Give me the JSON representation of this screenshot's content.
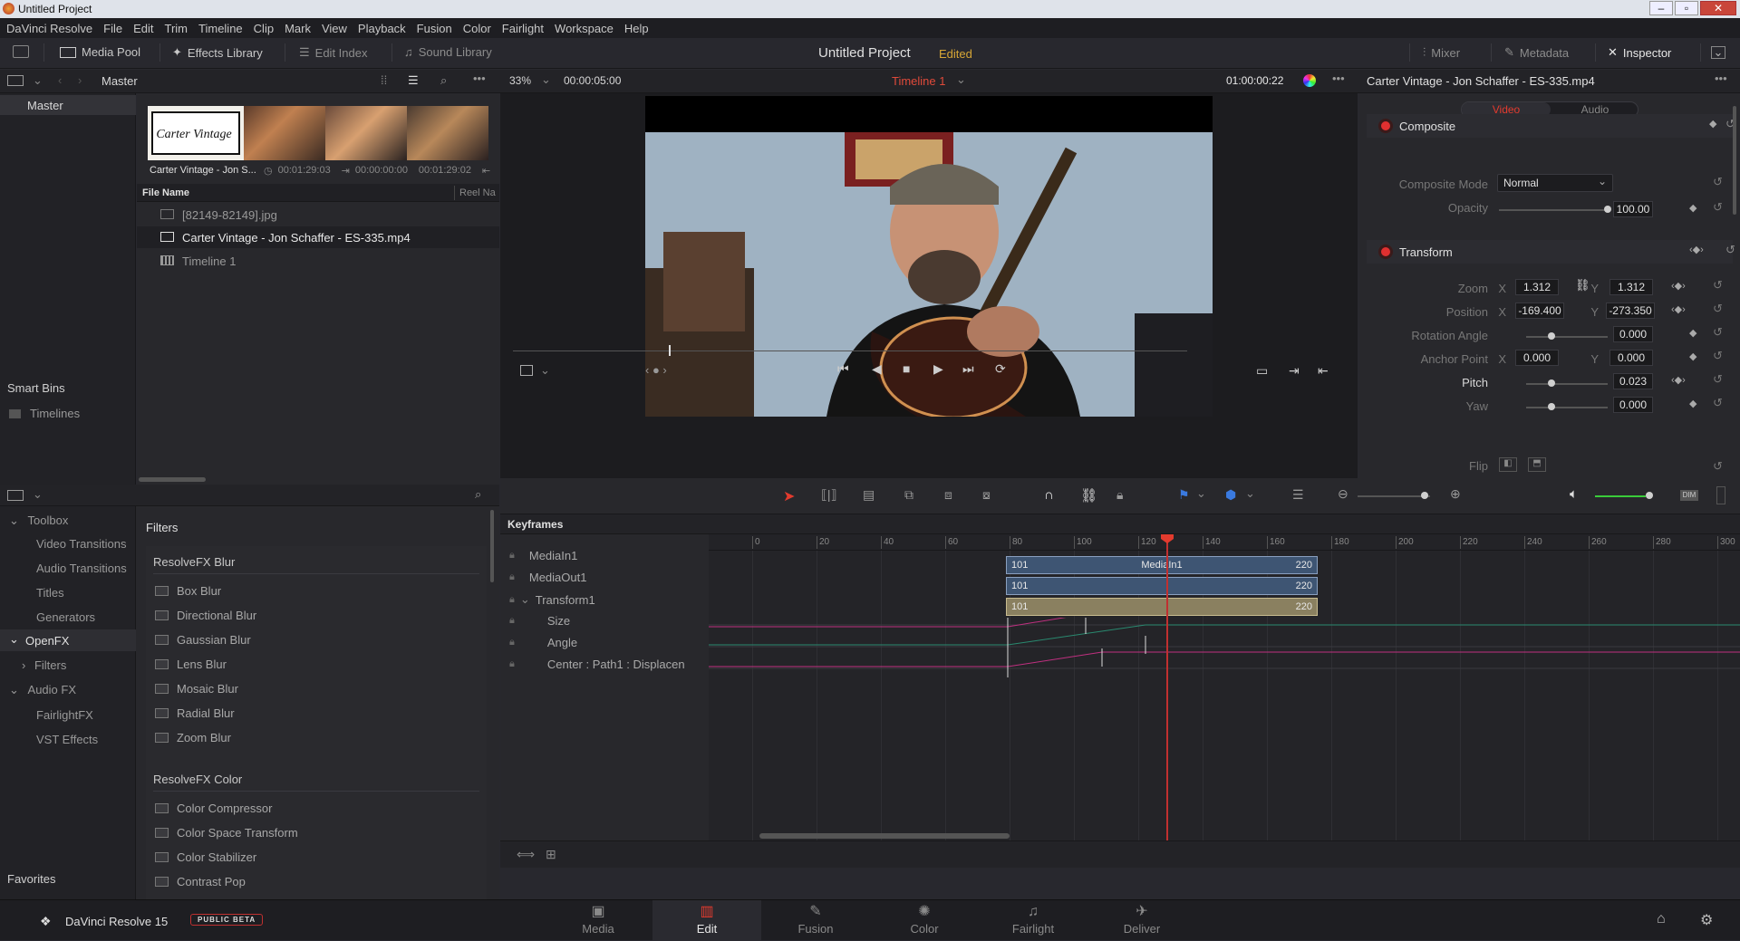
{
  "window": {
    "title": "Untitled Project"
  },
  "menu": [
    "DaVinci Resolve",
    "File",
    "Edit",
    "Trim",
    "Timeline",
    "Clip",
    "Mark",
    "View",
    "Playback",
    "Fusion",
    "Color",
    "Fairlight",
    "Workspace",
    "Help"
  ],
  "topbar": {
    "media_pool": "Media Pool",
    "effects_library": "Effects Library",
    "edit_index": "Edit Index",
    "sound_library": "Sound Library",
    "project_title": "Untitled Project",
    "project_status": "Edited",
    "mixer": "Mixer",
    "metadata": "Metadata",
    "inspector": "Inspector"
  },
  "subbar": {
    "bin_name": "Master",
    "zoom": "33%",
    "src_timecode": "00:00:05:00",
    "timeline_name": "Timeline 1",
    "rec_timecode": "01:00:00:22",
    "inspector_title": "Carter Vintage - Jon Schaffer - ES-335.mp4"
  },
  "bins": {
    "master": "Master",
    "smart_bins": "Smart Bins",
    "timelines": "Timelines"
  },
  "pool": {
    "thumb_label": "Carter Vintage - Jon S...",
    "thumb_duration": "00:01:29:03",
    "thumb_in": "00:00:00:00",
    "thumb_out": "00:01:29:02",
    "col_filename": "File Name",
    "col_reel": "Reel Na",
    "files": [
      "[82149-82149].jpg",
      "Carter Vintage - Jon Schaffer - ES-335.mp4",
      "Timeline 1"
    ],
    "thumb_logo_text": "Carter Vintage"
  },
  "inspector": {
    "tab_video": "Video",
    "tab_audio": "Audio",
    "composite": {
      "section": "Composite",
      "mode_label": "Composite Mode",
      "mode_value": "Normal",
      "opacity_label": "Opacity",
      "opacity_value": "100.00",
      "opacity_level": 1.0
    },
    "transform": {
      "section": "Transform",
      "zoom_label": "Zoom",
      "zoom_x": "1.312",
      "zoom_y": "1.312",
      "position_label": "Position",
      "position_x": "-169.400",
      "position_y": "-273.350",
      "rotation_label": "Rotation Angle",
      "rotation_value": "0.000",
      "anchor_label": "Anchor Point",
      "anchor_x": "0.000",
      "anchor_y": "0.000",
      "pitch_label": "Pitch",
      "pitch_value": "0.023",
      "yaw_label": "Yaw",
      "yaw_value": "0.000",
      "flip_label": "Flip",
      "x": "X",
      "y": "Y"
    }
  },
  "fxlib": {
    "toolbox": "Toolbox",
    "video_transitions": "Video Transitions",
    "audio_transitions": "Audio Transitions",
    "titles": "Titles",
    "generators": "Generators",
    "openfx": "OpenFX",
    "filters": "Filters",
    "audio_fx": "Audio FX",
    "fairlight_fx": "FairlightFX",
    "vst_effects": "VST Effects",
    "favorites": "Favorites",
    "panel_title": "Filters",
    "group_blur": "ResolveFX Blur",
    "blur_items": [
      "Box Blur",
      "Directional Blur",
      "Gaussian Blur",
      "Lens Blur",
      "Mosaic Blur",
      "Radial Blur",
      "Zoom Blur"
    ],
    "group_color": "ResolveFX Color",
    "color_items": [
      "Color Compressor",
      "Color Space Transform",
      "Color Stabilizer",
      "Contrast Pop"
    ]
  },
  "keyframes": {
    "title": "Keyframes",
    "ruler": [
      "0",
      "20",
      "40",
      "60",
      "80",
      "100",
      "120",
      "140",
      "160",
      "180",
      "200",
      "220",
      "240",
      "260",
      "280",
      "300"
    ],
    "tracks": [
      "MediaIn1",
      "MediaOut1",
      "Transform1",
      "Size",
      "Angle",
      "Center : Path1 : Displacen"
    ],
    "clip_start": "101",
    "clip_end": "220",
    "clip_name": "MediaIn1",
    "playhead_frame": 160
  },
  "bottomnav": {
    "app_name": "DaVinci Resolve 15",
    "badge": "PUBLIC BETA",
    "pages": [
      "Media",
      "Edit",
      "Fusion",
      "Color",
      "Fairlight",
      "Deliver"
    ],
    "active": "Edit"
  },
  "colors": {
    "accent_red": "#e03030",
    "clip_blue": "#3e5573",
    "clip_tan": "#8a8060",
    "playhead": "#e33b2e"
  }
}
